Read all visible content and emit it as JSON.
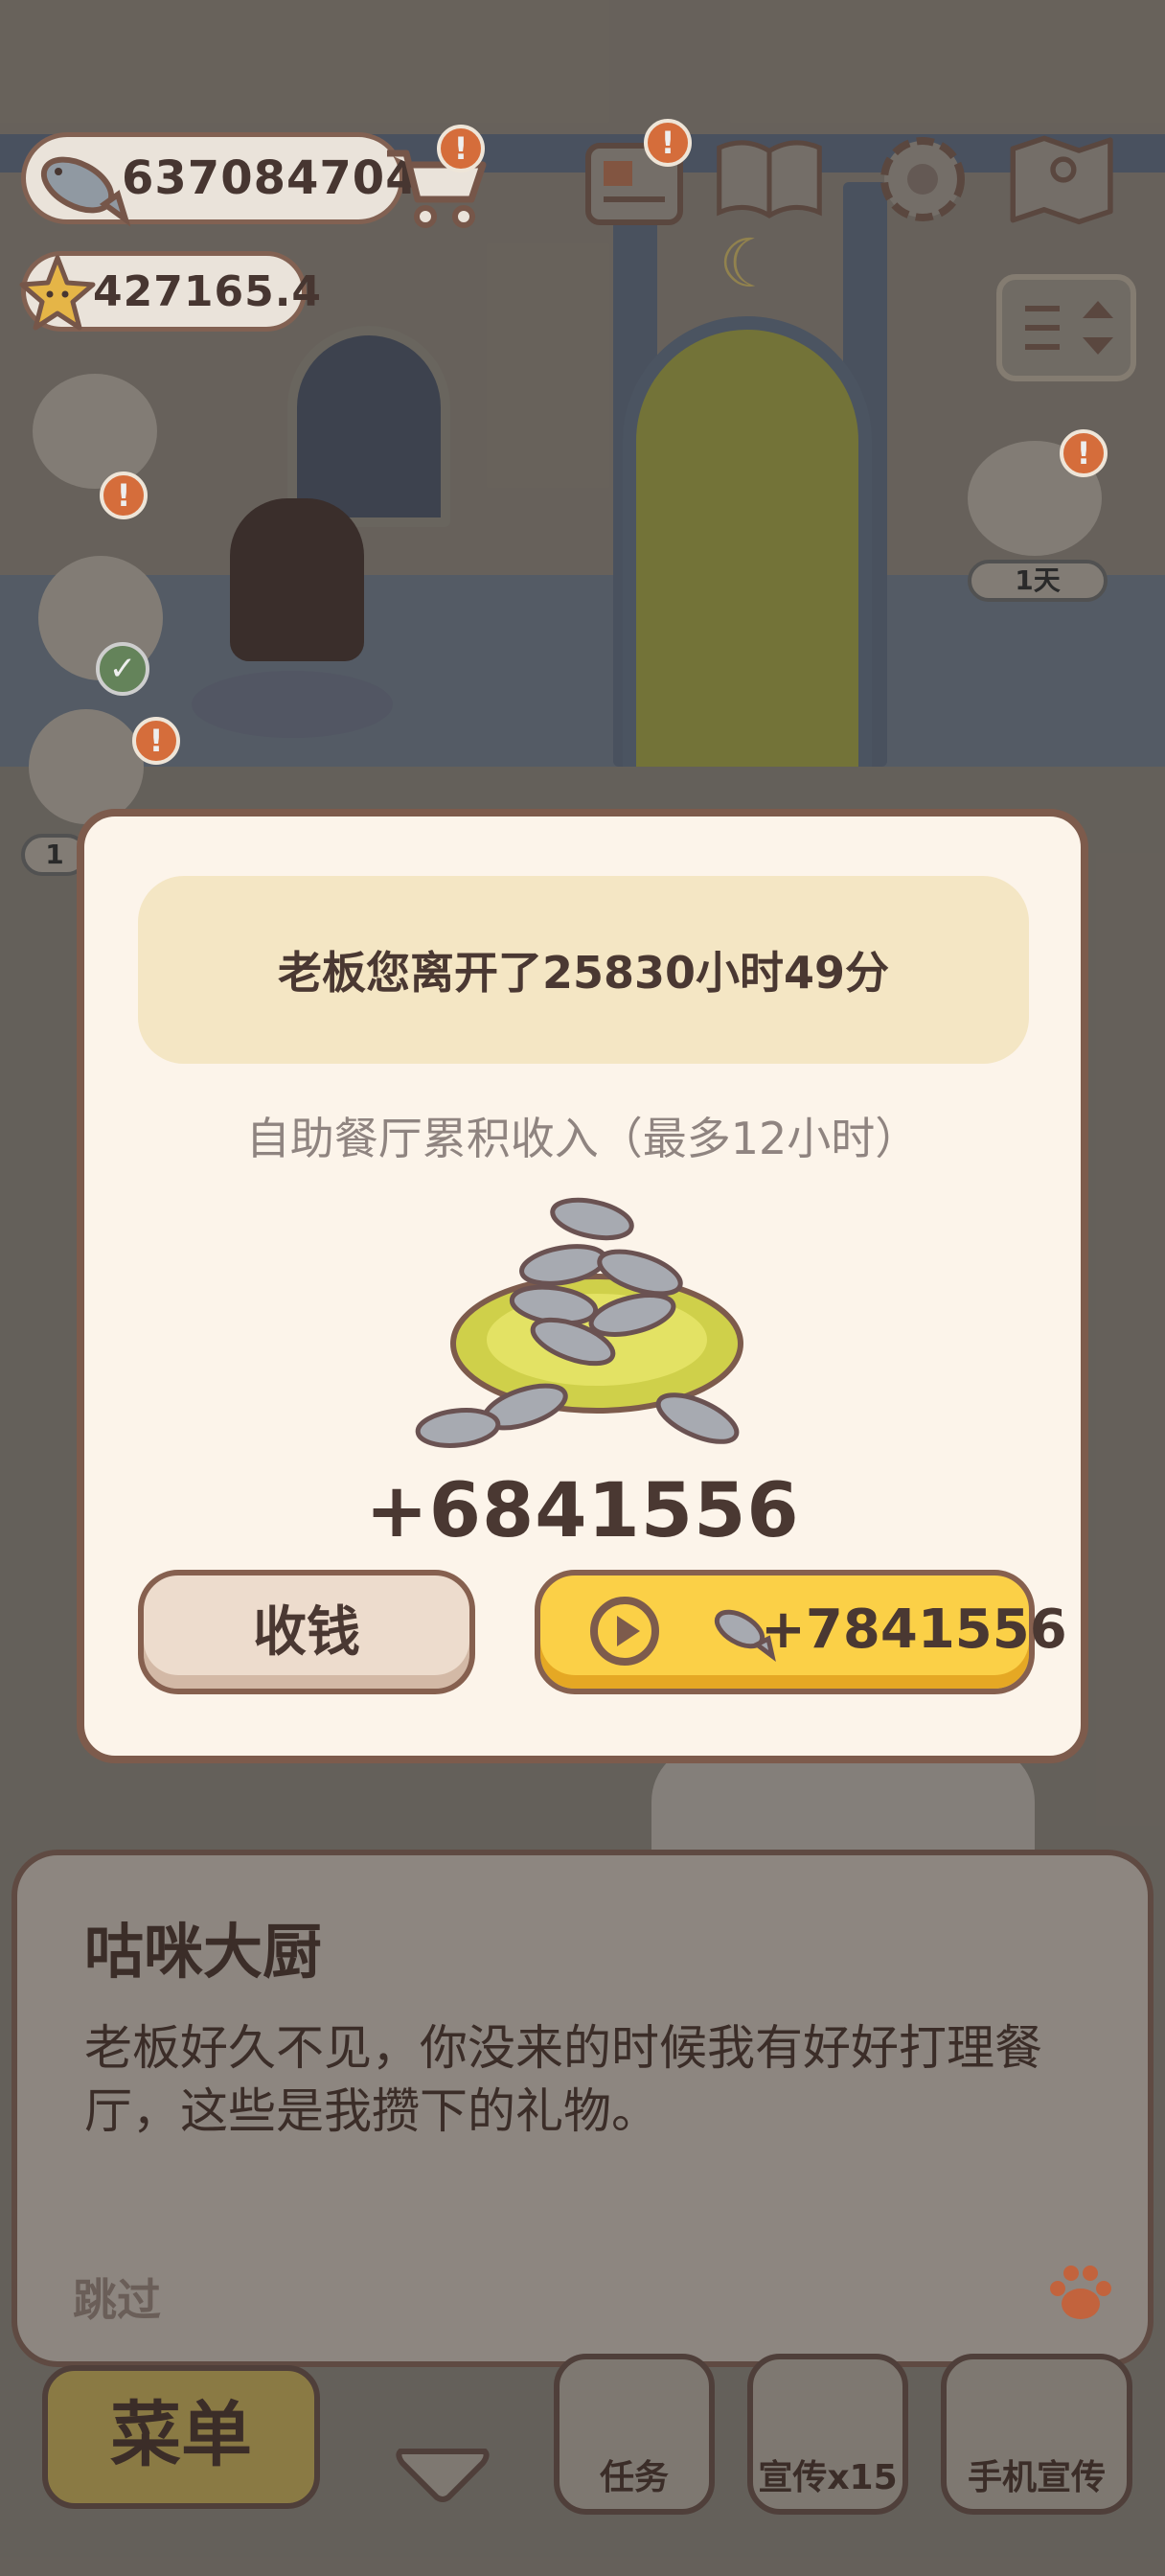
{
  "hud": {
    "fish_currency": "637084704",
    "star_currency": "427165.4",
    "alert_mark": "!"
  },
  "scene": {
    "day_label": "1天",
    "partial_label": "1"
  },
  "dialog": {
    "banner_text": "老板您离开了25830小时49分",
    "subtitle": "自助餐厅累积收入（最多12小时）",
    "earned": "+6841556",
    "collect_label": "收钱",
    "ad_reward": "+7841556"
  },
  "speech": {
    "speaker": "咕咪大厨",
    "text": "老板好久不见，你没来的时候我有好好打理餐厅，这些是我攒下的礼物。",
    "skip_label": "跳过"
  },
  "bottom_nav": {
    "menu_label": "菜单",
    "tasks_label": "任务",
    "promo_label": "宣传x15",
    "phone_promo_label": "手机宣传"
  },
  "colors": {
    "dialog_bg": "#fcf4ea",
    "dialog_border": "#7d5b4c",
    "banner_bg": "#f4e6c4",
    "ad_button": "#fbd047",
    "collect_button": "#eddccd",
    "badge": "#e4743d"
  },
  "icons": [
    "fish-icon",
    "star-icon",
    "cart-icon",
    "mail-icon",
    "book-icon",
    "gear-icon",
    "map-icon",
    "sort-icon",
    "play-icon",
    "paw-icon",
    "chevron-down-icon"
  ]
}
